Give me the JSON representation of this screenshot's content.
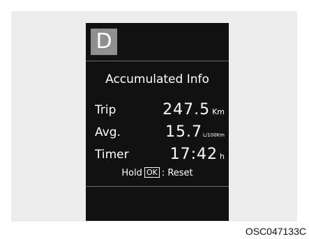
{
  "display": {
    "drive_mode": "D",
    "title": "Accumulated Info",
    "rows": [
      {
        "label": "Trip",
        "value": "247.5",
        "unit": "Km"
      },
      {
        "label": "Avg.",
        "value": "15.7",
        "unit": "L/100Km"
      },
      {
        "label": "Timer",
        "value": "17:42",
        "unit": "h"
      }
    ],
    "hint": {
      "prefix": "Hold",
      "key": "OK",
      "suffix": ": Reset"
    }
  },
  "caption": "OSC047133C",
  "colors": {
    "screen_background": "#111111",
    "drive_badge": "#8f8f8f",
    "text": "#ffffff",
    "surround": "#ececec"
  }
}
